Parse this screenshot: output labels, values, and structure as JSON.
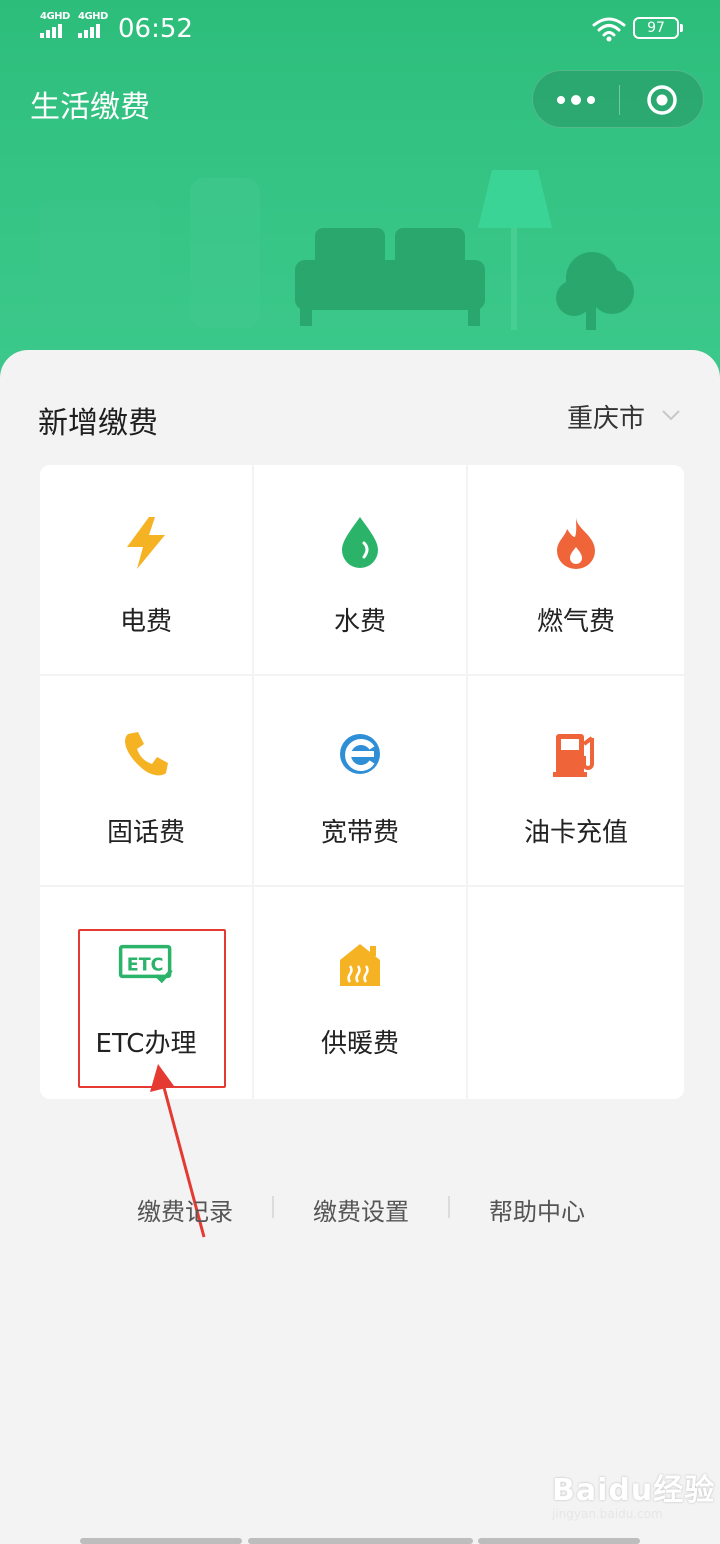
{
  "status_bar": {
    "network1": "4GHD",
    "network2": "4GHD",
    "time": "06:52",
    "battery": "97"
  },
  "header": {
    "title": "生活缴费"
  },
  "section": {
    "title": "新增缴费",
    "city": "重庆市"
  },
  "services": [
    {
      "label": "电费",
      "icon": "lightning-icon",
      "color": "#f5b324"
    },
    {
      "label": "水费",
      "icon": "water-drop-icon",
      "color": "#2cb36a"
    },
    {
      "label": "燃气费",
      "icon": "flame-icon",
      "color": "#ef6438"
    },
    {
      "label": "固话费",
      "icon": "phone-icon",
      "color": "#f5b324"
    },
    {
      "label": "宽带费",
      "icon": "broadband-e-icon",
      "color": "#2e8fd6"
    },
    {
      "label": "油卡充值",
      "icon": "fuel-pump-icon",
      "color": "#ef6438"
    },
    {
      "label": "ETC办理",
      "icon": "etc-icon",
      "color": "#2cb36a"
    },
    {
      "label": "供暖费",
      "icon": "heating-house-icon",
      "color": "#f5b324"
    }
  ],
  "footer_links": {
    "records": "缴费记录",
    "settings": "缴费设置",
    "help": "帮助中心"
  },
  "watermark": {
    "brand": "Baidu经验",
    "url": "jingyan.baidu.com"
  },
  "colors": {
    "header_green": "#37c586",
    "highlight_red": "#e53a32"
  }
}
